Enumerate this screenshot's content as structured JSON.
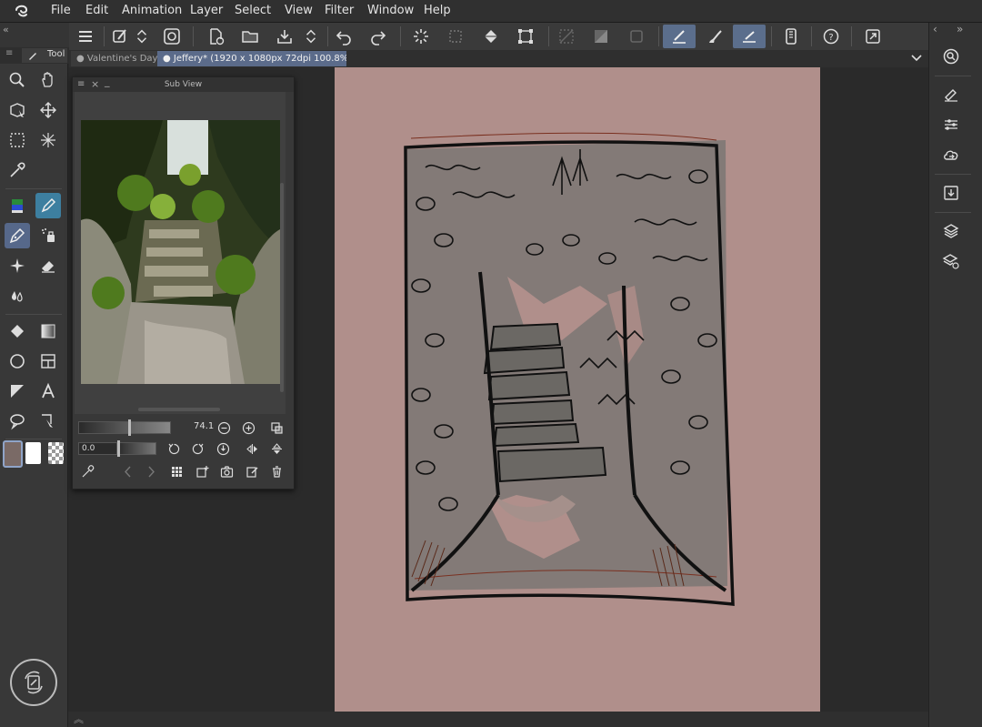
{
  "menubar": {
    "items": [
      "File",
      "Edit",
      "Animation",
      "Layer",
      "Select",
      "View",
      "Filter",
      "Window",
      "Help"
    ]
  },
  "tool_palette": {
    "label": "Tool"
  },
  "tabs": [
    {
      "label": "Valentine's Day"
    },
    {
      "label": "Jeffery* (1920 x 1080px 72dpi 100.8%)"
    }
  ],
  "subview": {
    "title": "Sub View",
    "zoom_value": "74.1",
    "rotation_value": "0.0"
  },
  "colors": {
    "canvas_paper": "#b08f8b",
    "accent_selected": "#56688a",
    "main_color": "#7a6a66",
    "sub_color": "#ffffff"
  },
  "icons": {
    "commands": [
      "hamburger-menu-icon",
      "tool-property-icon",
      "updown-icon",
      "spiral-icon",
      "new-file-icon",
      "open-file-icon",
      "save-icon",
      "updown-icon",
      "undo-icon",
      "redo-icon",
      "loading-icon",
      "clear-icon",
      "fill-icon",
      "transform-icon",
      "deselect-icon",
      "invert-icon",
      "crop-icon",
      "ruler-snap-icon",
      "brush-snap-icon",
      "line-snap-icon",
      "phone-icon",
      "help-icon",
      "fullscreen-icon"
    ]
  }
}
